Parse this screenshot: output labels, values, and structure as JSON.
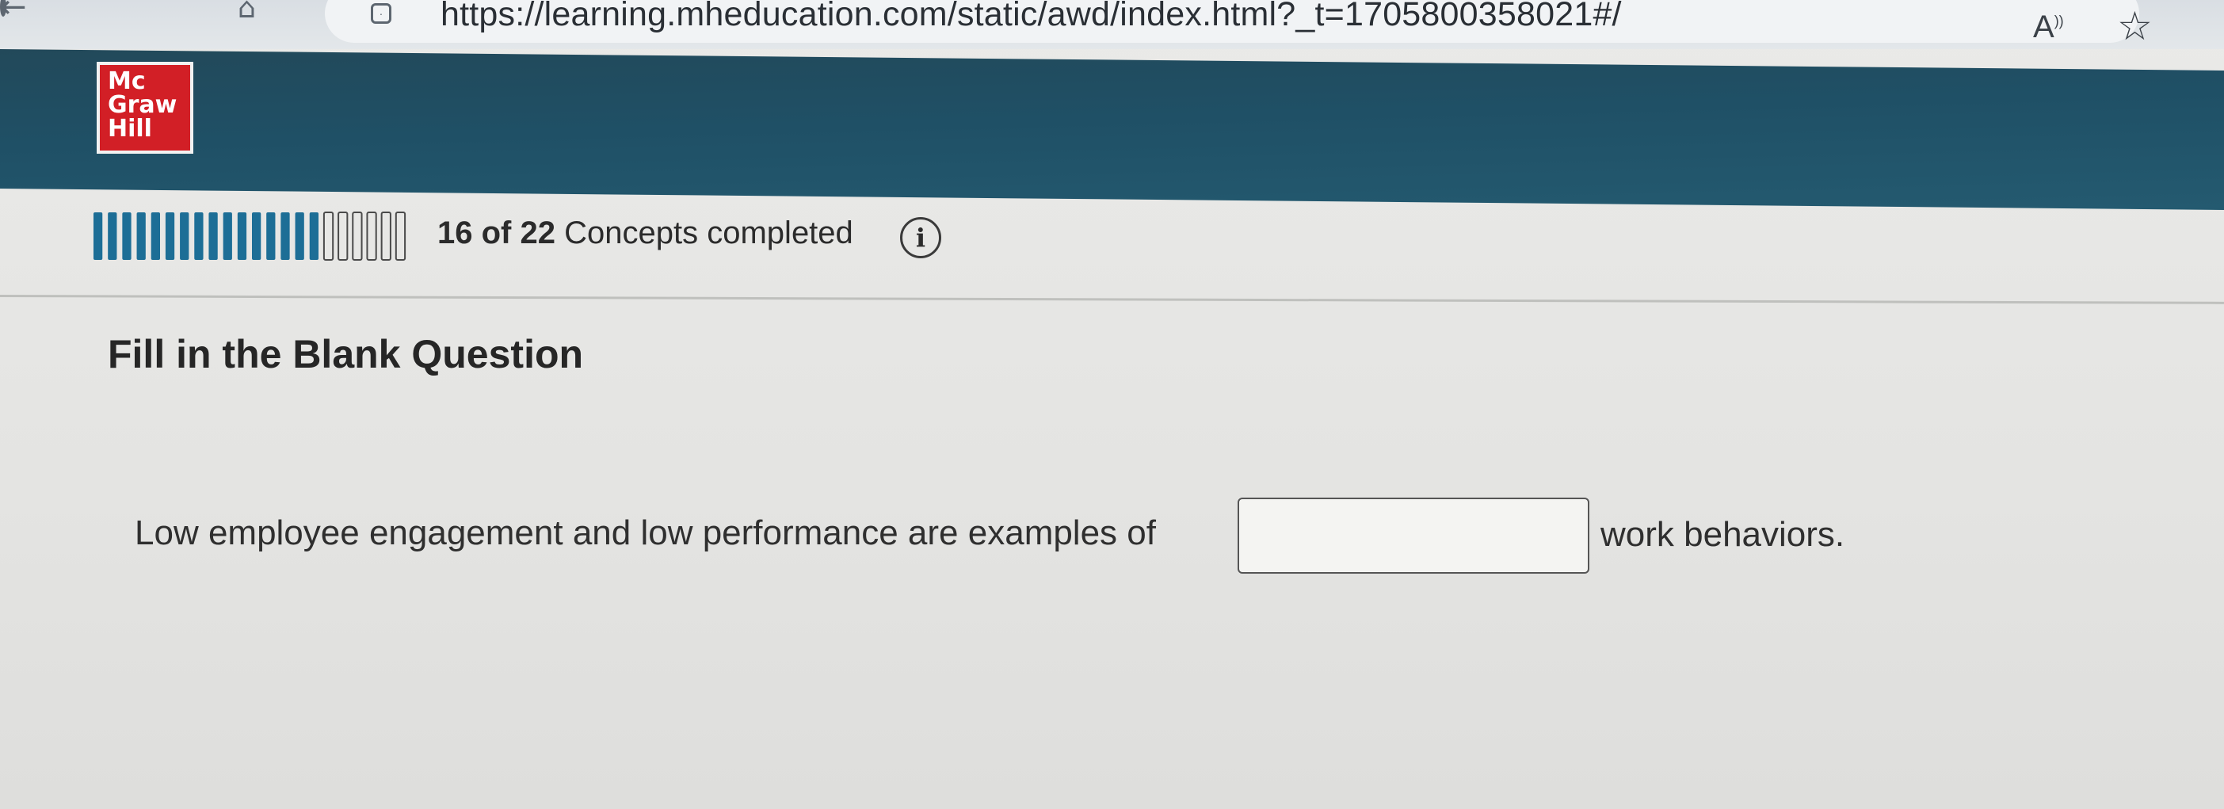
{
  "browser": {
    "url": "https://learning.mheducation.com/static/awd/index.html?_t=1705800358021#/",
    "read_aloud_glyph": "A",
    "read_aloud_sup": "))"
  },
  "header": {
    "brand_lines": [
      "Mc",
      "Graw",
      "Hill"
    ],
    "brand_color": "#d21f26",
    "bar_color": "#1f5066"
  },
  "progress": {
    "completed": "16",
    "of_word": "of",
    "total": "22",
    "label": "Concepts completed",
    "completed_count": 16,
    "total_count": 22,
    "filled_color": "#1d6e96",
    "info_glyph": "i"
  },
  "question": {
    "heading": "Fill in the Blank Question",
    "text_before": "Low employee engagement and low performance are examples of",
    "blank_value": "",
    "text_after": "work behaviors."
  },
  "icons": [
    "back-arrow-icon",
    "refresh-icon",
    "home-icon",
    "site-info-icon",
    "read-aloud-icon",
    "favorite-star-icon",
    "info-icon"
  ]
}
